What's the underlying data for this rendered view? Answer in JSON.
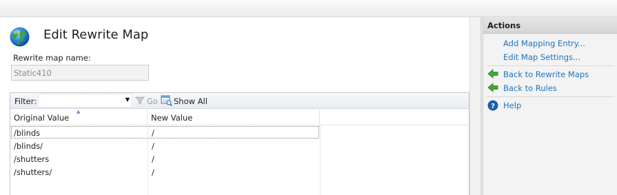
{
  "page": {
    "title": "Edit Rewrite Map",
    "map_name_label": "Rewrite map name:",
    "map_name_value": "Static410"
  },
  "toolbar": {
    "filter_label": "Filter:",
    "filter_value": "",
    "go_label": "Go",
    "show_all_label": "Show All"
  },
  "grid": {
    "columns": [
      "Original Value",
      "New Value"
    ],
    "rows": [
      {
        "original": "/blinds",
        "new": "/"
      },
      {
        "original": "/blinds/",
        "new": "/"
      },
      {
        "original": "/shutters",
        "new": "/"
      },
      {
        "original": "/shutters/",
        "new": "/"
      }
    ]
  },
  "actions": {
    "header": "Actions",
    "items": [
      {
        "label": "Add Mapping Entry...",
        "icon": "none"
      },
      {
        "label": "Edit Map Settings...",
        "icon": "none"
      },
      {
        "label": "Back to Rewrite Maps",
        "icon": "green-back-arrow-icon"
      },
      {
        "label": "Back to Rules",
        "icon": "green-back-arrow-icon"
      },
      {
        "label": "Help",
        "icon": "help-icon"
      }
    ]
  },
  "colors": {
    "link": "#1e73be",
    "back_arrow": "#3ea63a",
    "help": "#1d5fb5"
  }
}
